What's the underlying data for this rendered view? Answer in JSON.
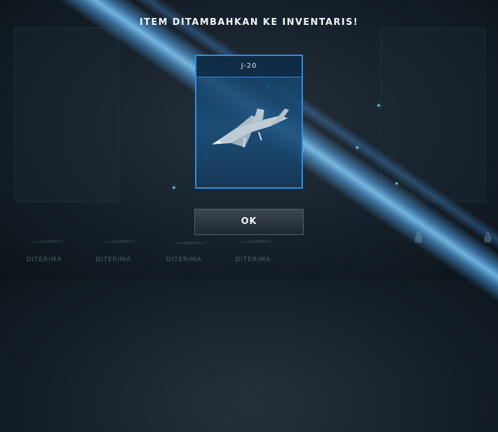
{
  "dialog": {
    "title": "ITEM DITAMBAHKAN KE INVENTARIS!",
    "item_name": "J-20",
    "item_icon": "stealth-fighter-jet",
    "ok_label": "OK"
  },
  "background_slots": [
    {
      "label": "DITERIMA"
    },
    {
      "label": "DITERIMA"
    },
    {
      "label": "DITERIMA"
    },
    {
      "label": "DITERIMA"
    }
  ],
  "colors": {
    "accent": "#2e8fe6",
    "beam": "#6ec4ff",
    "panel": "#1c507d"
  }
}
